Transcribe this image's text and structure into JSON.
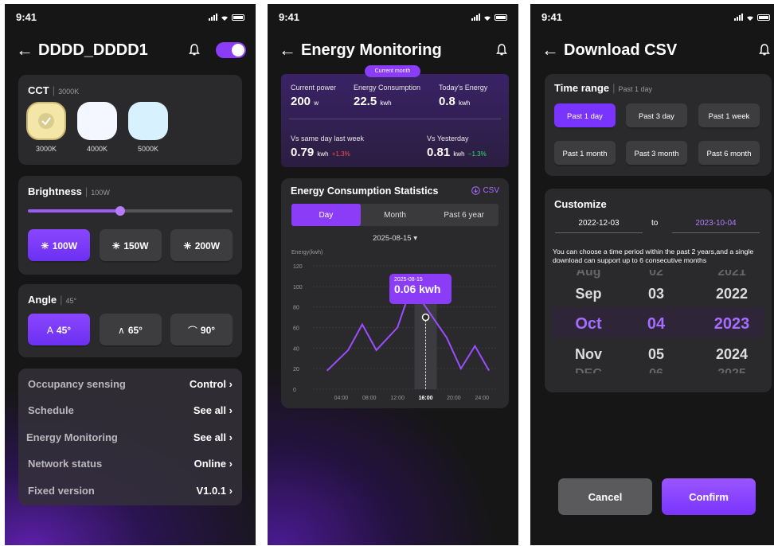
{
  "status": {
    "time": "9:41"
  },
  "screen1": {
    "title": "DDDD_DDDD1",
    "cct": {
      "label": "CCT",
      "value": "3000K",
      "options": [
        {
          "label": "3000K",
          "color": "#f3e6a6",
          "selected": true
        },
        {
          "label": "4000K",
          "color": "#f4f7ff"
        },
        {
          "label": "5000K",
          "color": "#d7f1ff"
        }
      ]
    },
    "brightness": {
      "label": "Brightness",
      "value": "100W",
      "level": 0.45,
      "options": [
        "100W",
        "150W",
        "200W"
      ]
    },
    "angle": {
      "label": "Angle",
      "value": "45°",
      "options": [
        "45°",
        "65°",
        "90°"
      ]
    },
    "menu": [
      {
        "key": "Occupancy sensing",
        "value": "Control"
      },
      {
        "key": "Schedule",
        "value": "See all"
      },
      {
        "key": "Energy Monitoring",
        "value": "See all"
      },
      {
        "key": "Network status",
        "value": "Online"
      },
      {
        "key": "Fixed version",
        "value": "V1.0.1"
      }
    ]
  },
  "screen2": {
    "title": "Energy Monitoring",
    "pill": "Current month",
    "stats": {
      "current_power": {
        "label": "Current power",
        "value": "200",
        "unit": "w"
      },
      "energy_consumption": {
        "label": "Energy Consumption",
        "value": "22.5",
        "unit": "kwh"
      },
      "today": {
        "label": "Today's Energy",
        "value": "0.8",
        "unit": "kwh"
      },
      "last_week": {
        "label": "Vs same day last week",
        "value": "0.79",
        "unit": "kwh",
        "delta": "+1.3%"
      },
      "yesterday": {
        "label": "Vs Yesterday",
        "value": "0.81",
        "unit": "kwh",
        "delta": "−1.3%"
      }
    },
    "stats_card": {
      "title": "Energy Consumption Statistics",
      "csv": "CSV",
      "tabs": [
        "Day",
        "Month",
        "Past 6 year"
      ],
      "date": "2025-08-15 ▾"
    },
    "tooltip": {
      "date": "2025-08-15",
      "value": "0.06 kwh"
    }
  },
  "chart_data": {
    "type": "line",
    "ylabel": "Energy(kwh)",
    "ylim": [
      0,
      120
    ],
    "yticks": [
      0,
      20,
      40,
      60,
      80,
      100,
      120
    ],
    "x": [
      "04:00",
      "08:00",
      "12:00",
      "16:00",
      "20:00",
      "24:00"
    ],
    "xticks": [
      "04:00",
      "08:00",
      "12:00",
      "16:00",
      "20:00",
      "24:00"
    ],
    "points": [
      [
        2,
        18
      ],
      [
        5,
        38
      ],
      [
        7,
        63
      ],
      [
        9,
        38
      ],
      [
        12,
        60
      ],
      [
        14,
        100
      ],
      [
        17,
        70
      ],
      [
        19,
        50
      ],
      [
        21,
        20
      ],
      [
        23,
        42
      ],
      [
        25,
        18
      ]
    ],
    "highlight_x": "16:00",
    "grid": true
  },
  "screen3": {
    "title": "Download CSV",
    "time_range": {
      "label": "Time range",
      "value": "Past 1 day",
      "options": [
        "Past 1 day",
        "Past 3 day",
        "Past 1 week",
        "Past 1 month",
        "Past 3 month",
        "Past 6 month"
      ]
    },
    "customize": {
      "label": "Customize",
      "from": "2022-12-03",
      "to_label": "to",
      "to": "2023-10-04",
      "hint": "You can choose a time period within the past 2 years,and a single download can support up to 6 consecutive months"
    },
    "wheel": {
      "months": [
        "Aug",
        "Sep",
        "Oct",
        "Nov",
        "DEC"
      ],
      "days": [
        "02",
        "03",
        "04",
        "05",
        "06"
      ],
      "years": [
        "2021",
        "2022",
        "2023",
        "2024",
        "2025"
      ]
    },
    "cancel": "Cancel",
    "confirm": "Confirm"
  },
  "colors": {
    "accent": "#8b3cf7",
    "card": "#2a2a2c",
    "bg": "#161616"
  }
}
